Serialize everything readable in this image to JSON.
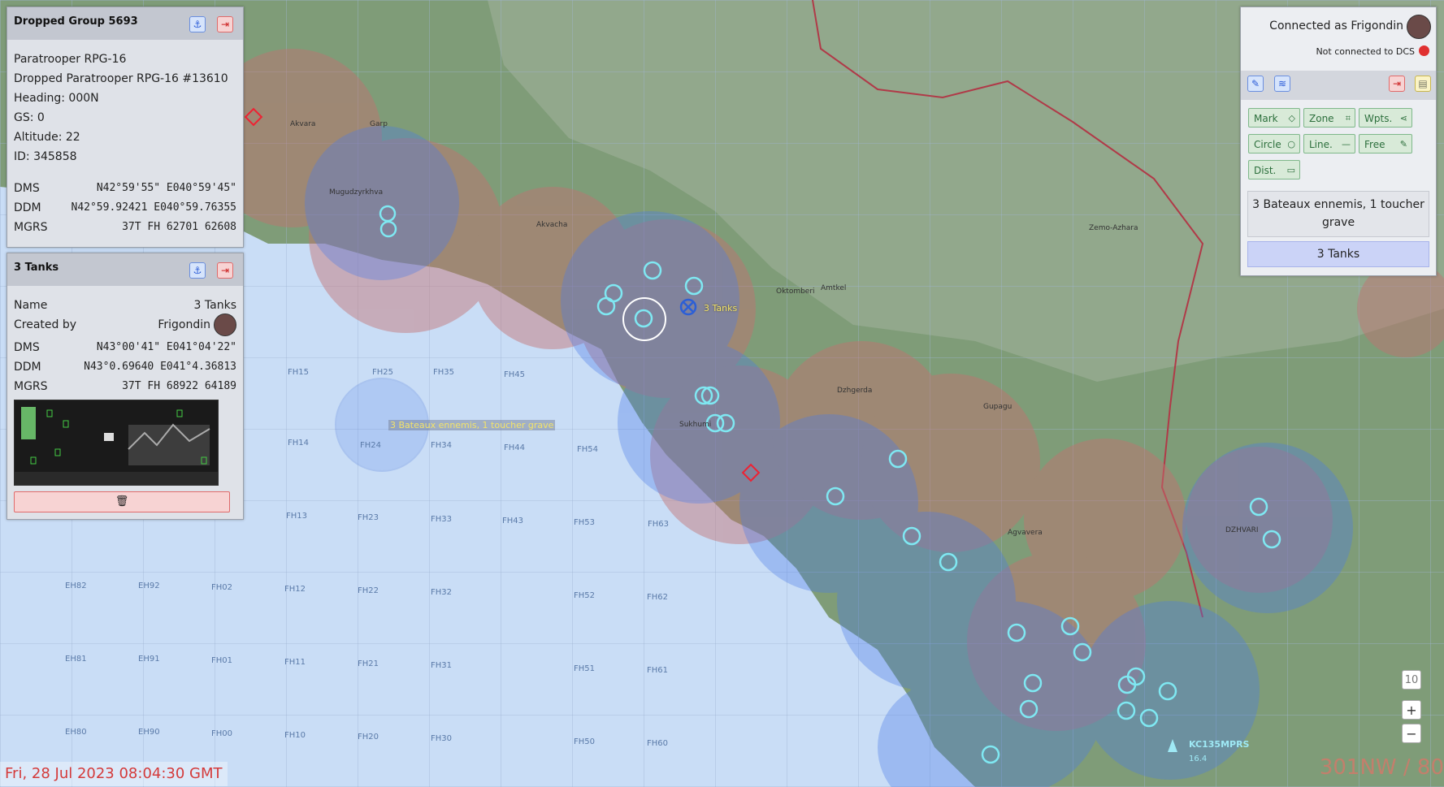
{
  "panel_group": {
    "title": "Dropped Group 5693",
    "unit_type": "Paratrooper RPG-16",
    "unit_name": "Dropped Paratrooper RPG-16 #13610",
    "heading": "Heading: 000N",
    "gs": "GS: 0",
    "altitude": "Altitude: 22",
    "id": "ID: 345858",
    "dms_label": "DMS",
    "dms_value": "N42°59'55\"  E040°59'45\"",
    "ddm_label": "DDM",
    "ddm_value": "N42°59.92421  E040°59.76355",
    "mgrs_label": "MGRS",
    "mgrs_value": "37T  FH  62701  62608"
  },
  "panel_marker": {
    "title": "3 Tanks",
    "name_label": "Name",
    "name_value": "3 Tanks",
    "created_label": "Created by",
    "created_value": "Frigondin",
    "dms_label": "DMS",
    "dms_value": "N43°00'41\"  E041°04'22\"",
    "ddm_label": "DDM",
    "ddm_value": "N43°0.69640  E041°4.36813",
    "mgrs_label": "MGRS",
    "mgrs_value": "37T  FH  68922  64189",
    "delete_icon": "trash-icon"
  },
  "connection": {
    "status": "Connected as Frigondin",
    "dcs_status": "Not connected to DCS",
    "dcs_color": "#e03030"
  },
  "tools": {
    "mark": "Mark",
    "zone": "Zone",
    "wpts": "Wpts.",
    "circle": "Circle",
    "line": "Line.",
    "free": "Free",
    "dist": "Dist."
  },
  "marker_list": [
    "3 Bateaux ennemis, 1 toucher grave",
    "3 Tanks"
  ],
  "map": {
    "marker_tanks": "3 Tanks",
    "marker_boats": "3 Bateaux ennemis, 1 toucher grave",
    "tanker": "KC135MPRS",
    "tanker_alt": "16.4",
    "wind": "301NW / 80",
    "timestamp": "Fri, 28 Jul 2023 08:04:30 GMT",
    "zoom_level": "10",
    "zoom_in": "+",
    "zoom_out": "−"
  },
  "colors": {
    "sea": "#c9ddf6",
    "land": "#7f9c78",
    "red_zone": "#c47070",
    "blue_zone": "#4a7be8",
    "panel_bg": "#dfe2e8",
    "panel_head": "#c3c7d0"
  }
}
